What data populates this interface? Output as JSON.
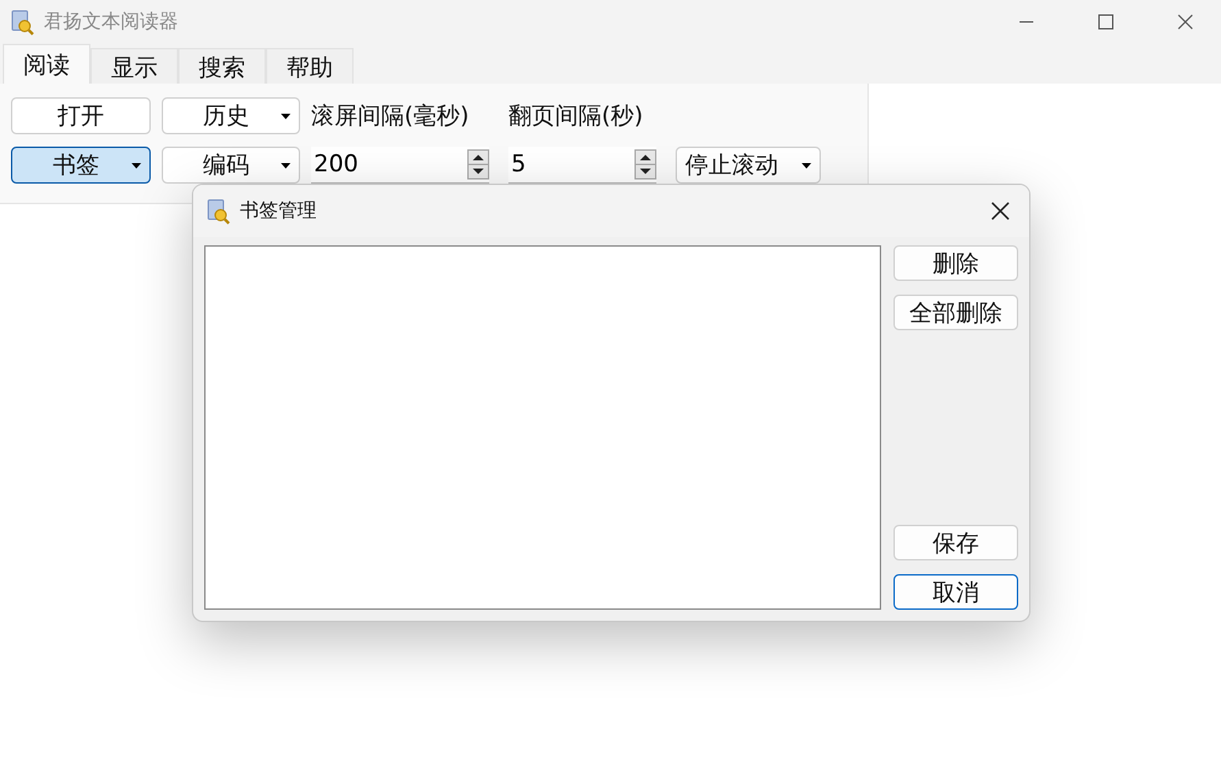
{
  "window": {
    "title": "君扬文本阅读器"
  },
  "tabs": [
    {
      "label": "阅读",
      "selected": true
    },
    {
      "label": "显示",
      "selected": false
    },
    {
      "label": "搜索",
      "selected": false
    },
    {
      "label": "帮助",
      "selected": false
    }
  ],
  "toolbar": {
    "row_1": [
      {
        "kind": "button",
        "label": "打开",
        "active": false
      },
      {
        "kind": "dropdown",
        "label": "历史",
        "active": false
      },
      {
        "kind": "label",
        "label": "滚屏间隔(毫秒)"
      },
      {
        "kind": "label",
        "label": "翻页间隔(秒)"
      }
    ],
    "row_2": [
      {
        "kind": "dropdown",
        "label": "书签",
        "active": true
      },
      {
        "kind": "dropdown",
        "label": "编码",
        "active": false
      },
      {
        "kind": "spin",
        "value": "200"
      },
      {
        "kind": "spin",
        "value": "5"
      },
      {
        "kind": "combo",
        "label": "停止滚动"
      }
    ]
  },
  "dialog": {
    "title": "书签管理",
    "top_buttons": [
      {
        "label": "删除",
        "default": false
      },
      {
        "label": "全部删除",
        "default": false
      }
    ],
    "bottom_buttons": [
      {
        "label": "保存",
        "default": false
      },
      {
        "label": "取消",
        "default": true
      }
    ]
  }
}
